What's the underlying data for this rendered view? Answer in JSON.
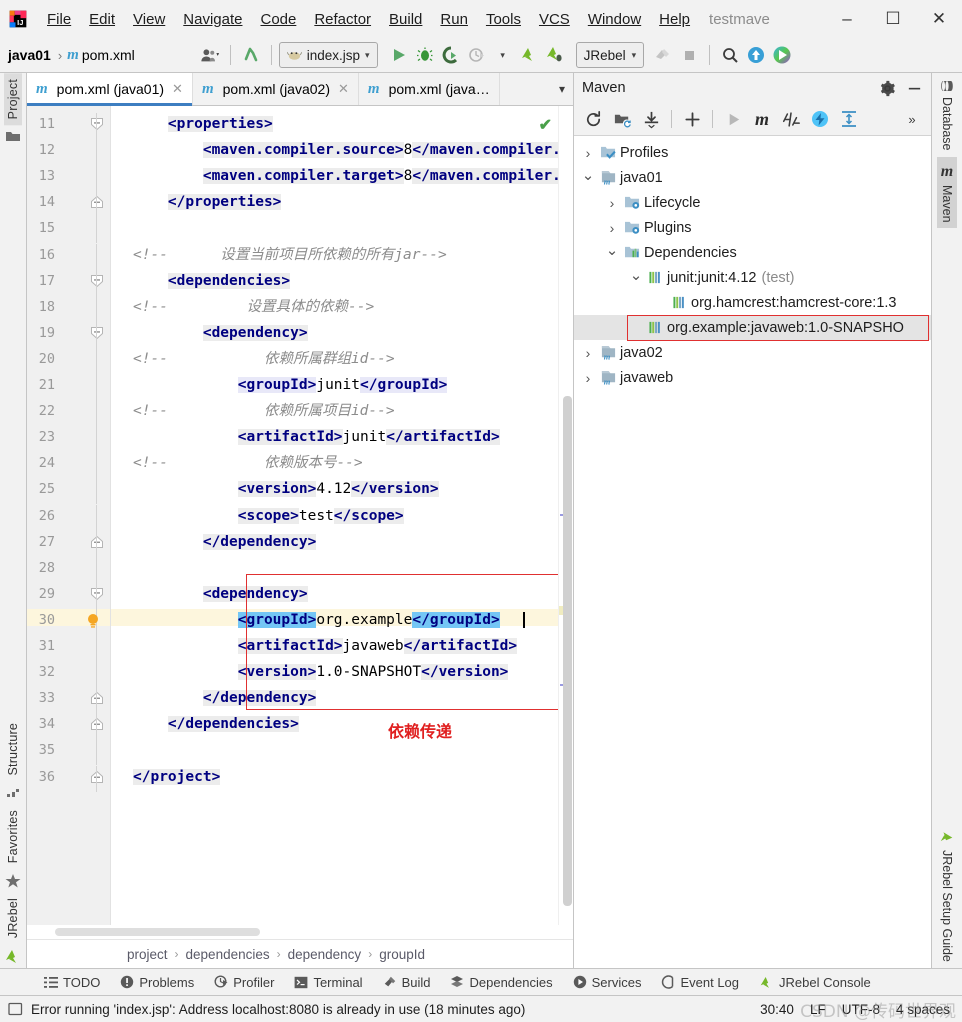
{
  "window": {
    "app_icon": "intellij-idea-logo",
    "project_name": "testmave",
    "menus": [
      "File",
      "Edit",
      "View",
      "Navigate",
      "Code",
      "Refactor",
      "Build",
      "Run",
      "Tools",
      "VCS",
      "Window",
      "Help"
    ],
    "controls": {
      "minimize": "–",
      "maximize": "☐",
      "close": "✕"
    }
  },
  "toolbar": {
    "breadcrumb_project": "java01",
    "breadcrumb_sep": "›",
    "breadcrumb_file": "pom.xml",
    "file_icon": "maven-m-icon",
    "run_config": "index.jsp",
    "run_config_icon": "tomcat-icon",
    "jrebel_label": "JRebel",
    "icons": [
      "user-avatar-icon",
      "vcs-update-icon",
      "run-icon",
      "debug-icon",
      "run-with-coverage-icon",
      "profile-icon",
      "jrebel-run-icon",
      "jrebel-debug-icon",
      "build-hammer-icon",
      "stop-icon",
      "search-icon",
      "update-project-icon",
      "ide-plugin-icon"
    ]
  },
  "left_strip": {
    "tabs": [
      "Project",
      "Structure",
      "Favorites",
      "JRebel"
    ],
    "selected": "Project"
  },
  "right_strip": {
    "tabs": [
      "Database",
      "Maven",
      "JRebel Setup Guide"
    ],
    "selected": "Maven"
  },
  "editor": {
    "tabs": [
      {
        "label": "pom.xml (java01)",
        "icon": "maven-m-icon",
        "active": true
      },
      {
        "label": "pom.xml (java02)",
        "icon": "maven-m-icon",
        "active": false
      },
      {
        "label": "pom.xml (java…",
        "icon": "maven-m-icon",
        "active": false
      }
    ],
    "tab_overflow_icon": "chevron-down-icon",
    "inspection_status": "✔",
    "first_line_number": 11,
    "caret_line": 30,
    "lines": [
      {
        "n": 11,
        "fold": "minus-circle",
        "tokens": [
          {
            "t": "    ",
            "c": "plain"
          },
          {
            "t": "<properties>",
            "c": "tag hl"
          }
        ]
      },
      {
        "n": 12,
        "tokens": [
          {
            "t": "        ",
            "c": "plain"
          },
          {
            "t": "<maven.compiler.source>",
            "c": "tag hl"
          },
          {
            "t": "8",
            "c": "txt"
          },
          {
            "t": "</maven.compiler.sou",
            "c": "tag hl"
          }
        ]
      },
      {
        "n": 13,
        "tokens": [
          {
            "t": "        ",
            "c": "plain"
          },
          {
            "t": "<maven.compiler.target>",
            "c": "tag hl"
          },
          {
            "t": "8",
            "c": "txt"
          },
          {
            "t": "</maven.compiler.tar",
            "c": "tag hl"
          }
        ]
      },
      {
        "n": 14,
        "fold": "minus-box",
        "tokens": [
          {
            "t": "    ",
            "c": "plain"
          },
          {
            "t": "</properties>",
            "c": "tag hl"
          }
        ]
      },
      {
        "n": 15,
        "tokens": []
      },
      {
        "n": 16,
        "tokens": [
          {
            "t": "<!--      设置当前项目所依赖的所有jar-->",
            "c": "cmt"
          }
        ]
      },
      {
        "n": 17,
        "fold": "minus-circle",
        "tokens": [
          {
            "t": "    ",
            "c": "plain"
          },
          {
            "t": "<dependencies>",
            "c": "tag hl"
          }
        ]
      },
      {
        "n": 18,
        "tokens": [
          {
            "t": "<!--         设置具体的依赖-->",
            "c": "cmt"
          }
        ]
      },
      {
        "n": 19,
        "fold": "minus-circle",
        "tokens": [
          {
            "t": "        ",
            "c": "plain"
          },
          {
            "t": "<dependency>",
            "c": "tag hl"
          }
        ]
      },
      {
        "n": 20,
        "tokens": [
          {
            "t": "<!--           依赖所属群组id-->",
            "c": "cmt"
          }
        ]
      },
      {
        "n": 21,
        "tokens": [
          {
            "t": "            ",
            "c": "plain"
          },
          {
            "t": "<groupId>",
            "c": "tag hlv"
          },
          {
            "t": "junit",
            "c": "txt"
          },
          {
            "t": "</groupId>",
            "c": "tag hlv"
          }
        ]
      },
      {
        "n": 22,
        "tokens": [
          {
            "t": "<!--           依赖所属项目id-->",
            "c": "cmt"
          }
        ]
      },
      {
        "n": 23,
        "tokens": [
          {
            "t": "            ",
            "c": "plain"
          },
          {
            "t": "<artifactId>",
            "c": "tag hl"
          },
          {
            "t": "junit",
            "c": "txt"
          },
          {
            "t": "</artifactId>",
            "c": "tag hl"
          }
        ]
      },
      {
        "n": 24,
        "tokens": [
          {
            "t": "<!--           依赖版本号-->",
            "c": "cmt"
          }
        ]
      },
      {
        "n": 25,
        "tokens": [
          {
            "t": "            ",
            "c": "plain"
          },
          {
            "t": "<version>",
            "c": "tag hl"
          },
          {
            "t": "4.12",
            "c": "txt"
          },
          {
            "t": "</version>",
            "c": "tag hl"
          }
        ]
      },
      {
        "n": 26,
        "tokens": [
          {
            "t": "            ",
            "c": "plain"
          },
          {
            "t": "<scope>",
            "c": "tag hl"
          },
          {
            "t": "test",
            "c": "txt"
          },
          {
            "t": "</scope>",
            "c": "tag hl"
          }
        ]
      },
      {
        "n": 27,
        "fold": "minus-box",
        "tokens": [
          {
            "t": "        ",
            "c": "plain"
          },
          {
            "t": "</dependency>",
            "c": "tag hl"
          }
        ]
      },
      {
        "n": 28,
        "tokens": []
      },
      {
        "n": 29,
        "fold": "minus-circle",
        "tokens": [
          {
            "t": "        ",
            "c": "plain"
          },
          {
            "t": "<dependency>",
            "c": "tag hl"
          }
        ]
      },
      {
        "n": 30,
        "bulb": true,
        "tokens": [
          {
            "t": "            ",
            "c": "plain"
          },
          {
            "t": "<groupId>",
            "c": "tag hlb"
          },
          {
            "t": "org.example",
            "c": "txt"
          },
          {
            "t": "</groupId>",
            "c": "tag hlb"
          }
        ]
      },
      {
        "n": 31,
        "tokens": [
          {
            "t": "            ",
            "c": "plain"
          },
          {
            "t": "<artifactId>",
            "c": "tag hl"
          },
          {
            "t": "javaweb",
            "c": "txt"
          },
          {
            "t": "</artifactId>",
            "c": "tag hl"
          }
        ]
      },
      {
        "n": 32,
        "tokens": [
          {
            "t": "            ",
            "c": "plain"
          },
          {
            "t": "<version>",
            "c": "tag hl"
          },
          {
            "t": "1.0-SNAPSHOT",
            "c": "txt"
          },
          {
            "t": "</version>",
            "c": "tag hl"
          }
        ]
      },
      {
        "n": 33,
        "fold": "minus-box",
        "tokens": [
          {
            "t": "        ",
            "c": "plain"
          },
          {
            "t": "</dependency>",
            "c": "tag hl"
          }
        ]
      },
      {
        "n": 34,
        "fold": "minus-box",
        "tokens": [
          {
            "t": "    ",
            "c": "plain"
          },
          {
            "t": "</dependencies>",
            "c": "tag hl"
          }
        ]
      },
      {
        "n": 35,
        "tokens": []
      },
      {
        "n": 36,
        "fold": "minus-box",
        "tokens": [
          {
            "t": "</project>",
            "c": "tag hl"
          }
        ]
      }
    ],
    "annotation": "依赖传递",
    "annotation_color": "#e02020",
    "breadcrumbs": [
      "project",
      "dependencies",
      "dependency",
      "groupId"
    ]
  },
  "maven_panel": {
    "title": "Maven",
    "header_icons": [
      "gear-icon",
      "minimize-icon"
    ],
    "toolbar_icons": [
      "reload-all-projects-icon",
      "add-maven-project-icon",
      "download-sources-icon",
      "plus-icon",
      "run-icon",
      "execute-maven-goal-icon",
      "toggle-skip-tests-icon",
      "toggle-offline-icon",
      "expand-all-icon",
      "more-chevrons-icon"
    ],
    "tree": [
      {
        "label": "Profiles",
        "icon": "profiles-icon",
        "arrow": "collapsed",
        "depth": 0
      },
      {
        "label": "java01",
        "icon": "maven-project-icon",
        "arrow": "expanded",
        "depth": 0
      },
      {
        "label": "Lifecycle",
        "icon": "lifecycle-icon",
        "arrow": "collapsed",
        "depth": 1
      },
      {
        "label": "Plugins",
        "icon": "plugins-icon",
        "arrow": "collapsed",
        "depth": 1
      },
      {
        "label": "Dependencies",
        "icon": "dependencies-icon",
        "arrow": "expanded",
        "depth": 1
      },
      {
        "label": "junit:junit:4.12",
        "suffix": "(test)",
        "icon": "library-icon",
        "arrow": "expanded",
        "depth": 2
      },
      {
        "label": "org.hamcrest:hamcrest-core:1.3",
        "icon": "library-icon",
        "arrow": "none",
        "depth": 3
      },
      {
        "label": "org.example:javaweb:1.0-SNAPSHO",
        "icon": "library-icon",
        "arrow": "none",
        "depth": 2,
        "selected": true,
        "highlight": true
      },
      {
        "label": "java02",
        "icon": "maven-project-icon",
        "arrow": "collapsed",
        "depth": 0
      },
      {
        "label": "javaweb",
        "icon": "maven-project-icon",
        "arrow": "collapsed",
        "depth": 0
      }
    ]
  },
  "tool_windows": [
    {
      "label": "TODO",
      "icon": "todo-list-icon"
    },
    {
      "label": "Problems",
      "icon": "problems-icon"
    },
    {
      "label": "Profiler",
      "icon": "profiler-icon"
    },
    {
      "label": "Terminal",
      "icon": "terminal-icon"
    },
    {
      "label": "Build",
      "icon": "build-hammer-icon"
    },
    {
      "label": "Dependencies",
      "icon": "dependencies-stack-icon"
    },
    {
      "label": "Services",
      "icon": "services-icon"
    },
    {
      "label": "Event Log",
      "icon": "event-log-icon"
    },
    {
      "label": "JRebel Console",
      "icon": "jrebel-icon"
    }
  ],
  "status_bar": {
    "icon": "message-icon",
    "message": "Error running 'index.jsp': Address localhost:8080 is already in use (18 minutes ago)",
    "caret_position": "30:40",
    "line_separator": "LF",
    "encoding": "UTF-8",
    "indent": "4 spaces",
    "watermark": "CSDN @传码世界观"
  },
  "colors": {
    "accent_blue": "#3d7ec1",
    "tag": "#000080",
    "comment": "#8c8c8c",
    "red_box": "#e03030",
    "caret_line": "#fdf6dd",
    "selection": "#74c6f5",
    "panel_bg": "#f2f2f2"
  }
}
